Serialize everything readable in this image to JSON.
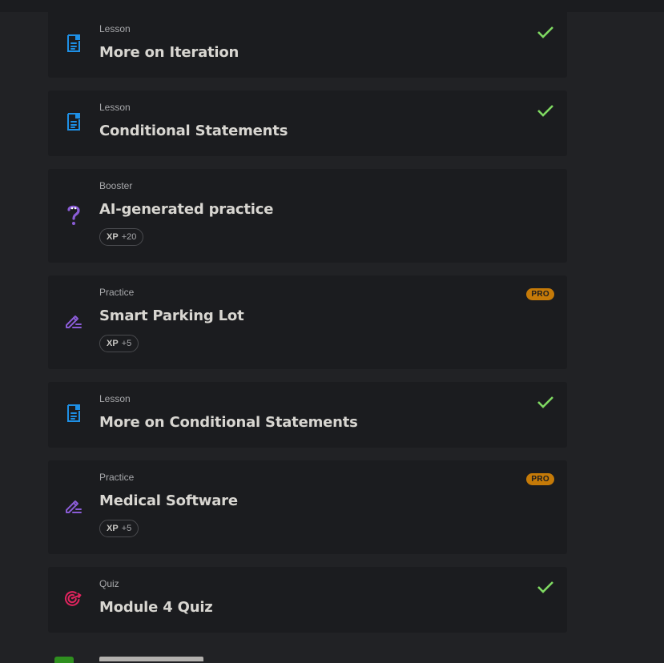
{
  "items": [
    {
      "type": "Lesson",
      "title": "More on Iteration",
      "icon": "lesson-document-icon",
      "done": true
    },
    {
      "type": "Lesson",
      "title": "Conditional Statements",
      "icon": "lesson-document-icon",
      "done": true
    },
    {
      "type": "Booster",
      "title": "AI-generated practice",
      "icon": "question-mark-icon",
      "xp_label": "XP",
      "xp_value": "+20"
    },
    {
      "type": "Practice",
      "title": "Smart Parking Lot",
      "icon": "pencil-practice-icon",
      "badge": "PRO",
      "xp_label": "XP",
      "xp_value": "+5"
    },
    {
      "type": "Lesson",
      "title": "More on Conditional Statements",
      "icon": "lesson-document-icon",
      "done": true
    },
    {
      "type": "Practice",
      "title": "Medical Software",
      "icon": "pencil-practice-icon",
      "badge": "PRO",
      "xp_label": "XP",
      "xp_value": "+5"
    },
    {
      "type": "Quiz",
      "title": "Module 4 Quiz",
      "icon": "target-quiz-icon",
      "done": true
    }
  ],
  "colors": {
    "background": "#212225",
    "card": "#1b1c1f",
    "lesson_icon": "#1e90e6",
    "practice_icon": "#8a5cd6",
    "quiz_icon": "#e0245e",
    "check": "#7fd962",
    "pro_badge": "#c57a08"
  }
}
